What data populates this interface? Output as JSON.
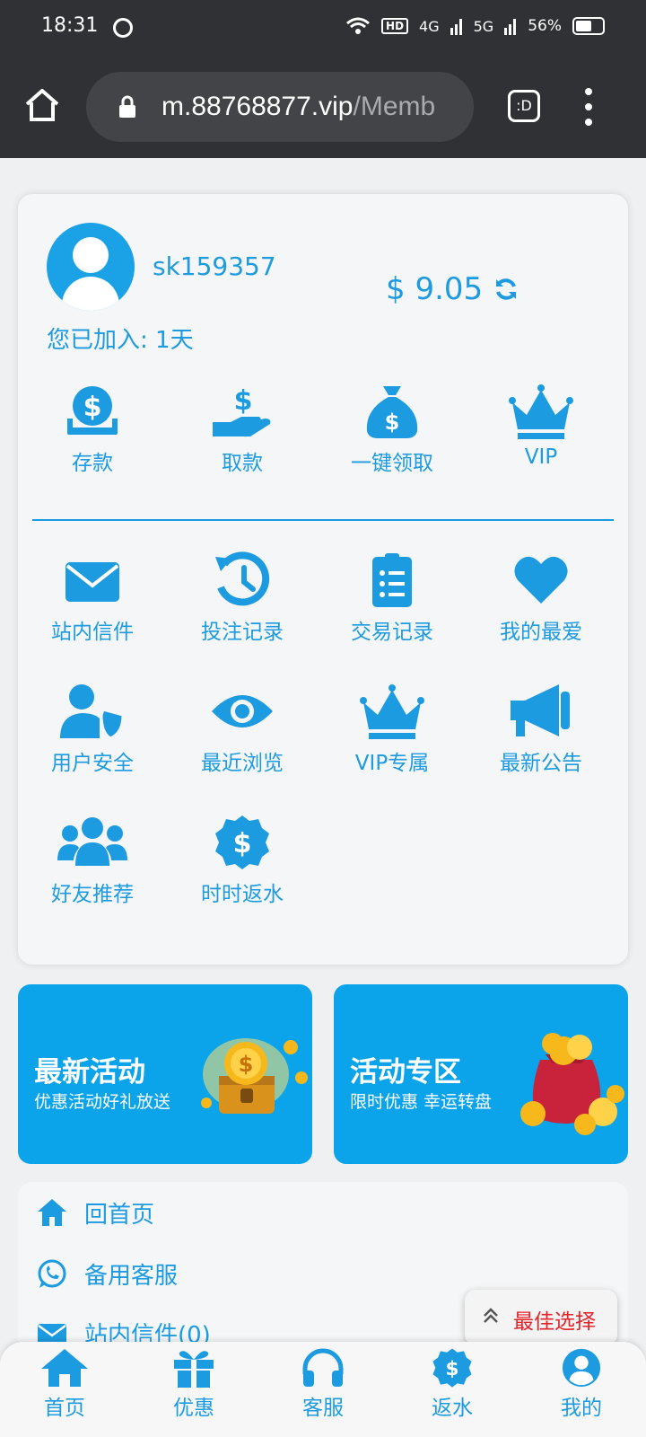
{
  "status_bar": {
    "time": "18:31",
    "network_type": "HD",
    "signal_1": "4G",
    "signal_2": "5G",
    "battery": "56%"
  },
  "browser": {
    "url_host": "m.88768877.vip",
    "url_path": "/Memb",
    "tabs_label": ":D"
  },
  "user": {
    "username": "sk159357",
    "balance": "$ 9.05",
    "joined": "您已加入: 1天"
  },
  "quick_actions": [
    {
      "label": "存款",
      "icon": "deposit-icon"
    },
    {
      "label": "取款",
      "icon": "withdraw-icon"
    },
    {
      "label": "一键领取",
      "icon": "money-bag-icon"
    },
    {
      "label": "VIP",
      "icon": "crown-icon"
    }
  ],
  "menu_grid": [
    {
      "label": "站内信件",
      "icon": "envelope-icon"
    },
    {
      "label": "投注记录",
      "icon": "history-icon"
    },
    {
      "label": "交易记录",
      "icon": "clipboard-icon"
    },
    {
      "label": "我的最爱",
      "icon": "heart-icon"
    },
    {
      "label": "用户安全",
      "icon": "user-shield-icon"
    },
    {
      "label": "最近浏览",
      "icon": "eye-icon"
    },
    {
      "label": "VIP专属",
      "icon": "crown-icon"
    },
    {
      "label": "最新公告",
      "icon": "megaphone-icon"
    },
    {
      "label": "好友推荐",
      "icon": "users-icon"
    },
    {
      "label": "时时返水",
      "icon": "dollar-badge-icon"
    }
  ],
  "promos": [
    {
      "title": "最新活动",
      "subtitle": "优惠活动好礼放送"
    },
    {
      "title": "活动专区",
      "subtitle": "限时优惠 幸运转盘"
    }
  ],
  "links": [
    {
      "label": "回首页",
      "icon": "home-icon"
    },
    {
      "label": "备用客服",
      "icon": "whatsapp-icon"
    },
    {
      "label": "站内信件(0)",
      "icon": "envelope-icon"
    }
  ],
  "best_choice": "最佳选择",
  "bottom_nav": [
    {
      "label": "首页",
      "icon": "home-icon"
    },
    {
      "label": "优惠",
      "icon": "gift-icon"
    },
    {
      "label": "客服",
      "icon": "headset-icon"
    },
    {
      "label": "返水",
      "icon": "dollar-badge-icon"
    },
    {
      "label": "我的",
      "icon": "user-circle-icon"
    }
  ],
  "colors": {
    "accent": "#1d9be0",
    "promo_bg": "#0ba3ea",
    "browser_bar": "#2f3134",
    "best_choice_text": "#e3242b"
  }
}
